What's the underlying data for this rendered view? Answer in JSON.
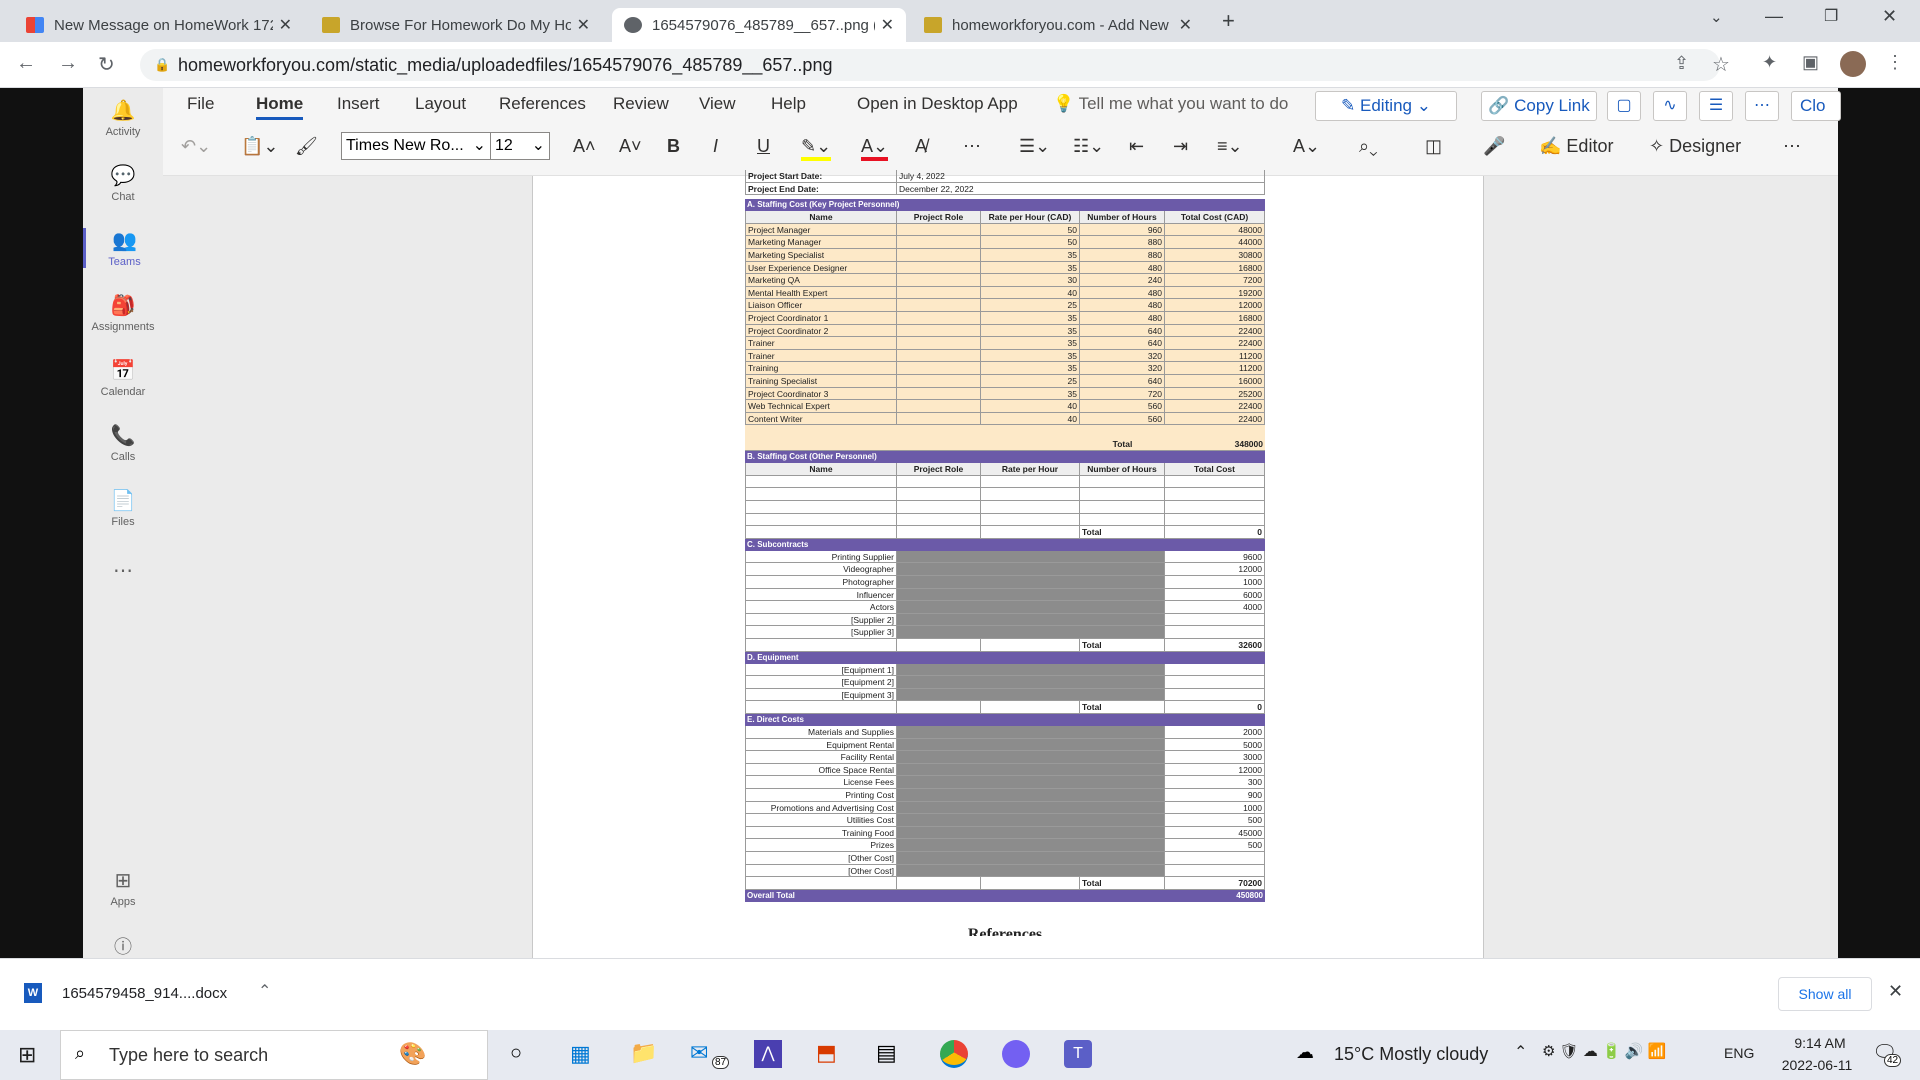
{
  "browser": {
    "tabs": [
      {
        "label": "New Message on HomeWork 172",
        "icon": "gmail-icon"
      },
      {
        "label": "Browse For Homework Do My Ho",
        "icon": "homework-icon"
      },
      {
        "label": "1654579076_485789__657..png (",
        "icon": "globe-icon"
      },
      {
        "label": "homeworkforyou.com - Add New",
        "icon": "homework-icon"
      }
    ],
    "url": "homeworkforyou.com/static_media/uploadedfiles/1654579076_485789__657..png"
  },
  "rail": [
    "Activity",
    "Chat",
    "Teams",
    "Assignments",
    "Calendar",
    "Calls",
    "Files",
    "Apps"
  ],
  "menu": [
    "File",
    "Home",
    "Insert",
    "Layout",
    "References",
    "Review",
    "View",
    "Help",
    "Open in Desktop App"
  ],
  "tellme": "Tell me what you want to do",
  "editing": "Editing",
  "copylink": "Copy Link",
  "font": "Times New Ro...",
  "size": "12",
  "editor": "Editor",
  "designer": "Designer",
  "clo": "Clo",
  "sheet": {
    "start_label": "Project Start Date:",
    "start": "July 4, 2022",
    "end_label": "Project End Date:",
    "end": "December 22, 2022",
    "a_title": "A. Staffing Cost (Key Project Personnel)",
    "cols": [
      "Name",
      "Project Role",
      "Rate per Hour (CAD)",
      "Number of Hours",
      "Total Cost (CAD)"
    ],
    "staff": [
      [
        "Project Manager",
        "50",
        "960",
        "48000"
      ],
      [
        "Marketing Manager",
        "50",
        "880",
        "44000"
      ],
      [
        "Marketing Specialist",
        "35",
        "880",
        "30800"
      ],
      [
        "User Experience Designer",
        "35",
        "480",
        "16800"
      ],
      [
        "Marketing QA",
        "30",
        "240",
        "7200"
      ],
      [
        "Mental Health Expert",
        "40",
        "480",
        "19200"
      ],
      [
        "Liaison Officer",
        "25",
        "480",
        "12000"
      ],
      [
        "Project Coordinator 1",
        "35",
        "480",
        "16800"
      ],
      [
        "Project Coordinator 2",
        "35",
        "640",
        "22400"
      ],
      [
        "Trainer",
        "35",
        "640",
        "22400"
      ],
      [
        "Trainer",
        "35",
        "320",
        "11200"
      ],
      [
        "Training",
        "35",
        "320",
        "11200"
      ],
      [
        "Training Specialist",
        "25",
        "640",
        "16000"
      ],
      [
        "Project Coordinator 3",
        "35",
        "720",
        "25200"
      ],
      [
        "Web Technical Expert",
        "40",
        "560",
        "22400"
      ],
      [
        "Content Writer",
        "40",
        "560",
        "22400"
      ]
    ],
    "a_total_label": "Total",
    "a_total": "348000",
    "b_title": "B. Staffing Cost (Other Personnel)",
    "b_cols": [
      "Name",
      "Project Role",
      "Rate per Hour",
      "Number of Hours",
      "Total Cost"
    ],
    "b_total": "0",
    "c_title": "C. Subcontracts",
    "subs": [
      [
        "Printing Supplier",
        "9600"
      ],
      [
        "Videographer",
        "12000"
      ],
      [
        "Photographer",
        "1000"
      ],
      [
        "Influencer",
        "6000"
      ],
      [
        "Actors",
        "4000"
      ],
      [
        "[Supplier 2]",
        ""
      ],
      [
        "[Supplier 3]",
        ""
      ]
    ],
    "c_total": "32600",
    "d_title": "D. Equipment",
    "equip": [
      "[Equipment 1]",
      "[Equipment 2]",
      "[Equipment 3]"
    ],
    "d_total": "0",
    "e_title": "E. Direct Costs",
    "direct": [
      [
        "Materials and Supplies",
        "2000"
      ],
      [
        "Equipment Rental",
        "5000"
      ],
      [
        "Facility Rental",
        "3000"
      ],
      [
        "Office Space Rental",
        "12000"
      ],
      [
        "License Fees",
        "300"
      ],
      [
        "Printing Cost",
        "900"
      ],
      [
        "Promotions and Advertising Cost",
        "1000"
      ],
      [
        "Utilities Cost",
        "500"
      ],
      [
        "Training Food",
        "45000"
      ],
      [
        "Prizes",
        "500"
      ],
      [
        "[Other Cost]",
        ""
      ],
      [
        "[Other Cost]",
        ""
      ]
    ],
    "e_total": "70200",
    "overall_label": "Overall Total",
    "overall": "450800",
    "references": "References"
  },
  "download": {
    "file": "1654579458_914....docx",
    "show_all": "Show all"
  },
  "taskbar": {
    "search": "Type here to search",
    "weather": "15°C  Mostly cloudy",
    "lang": "ENG",
    "time": "9:14 AM",
    "date": "2022-06-11",
    "mail_badge": "87",
    "notif": "42"
  }
}
